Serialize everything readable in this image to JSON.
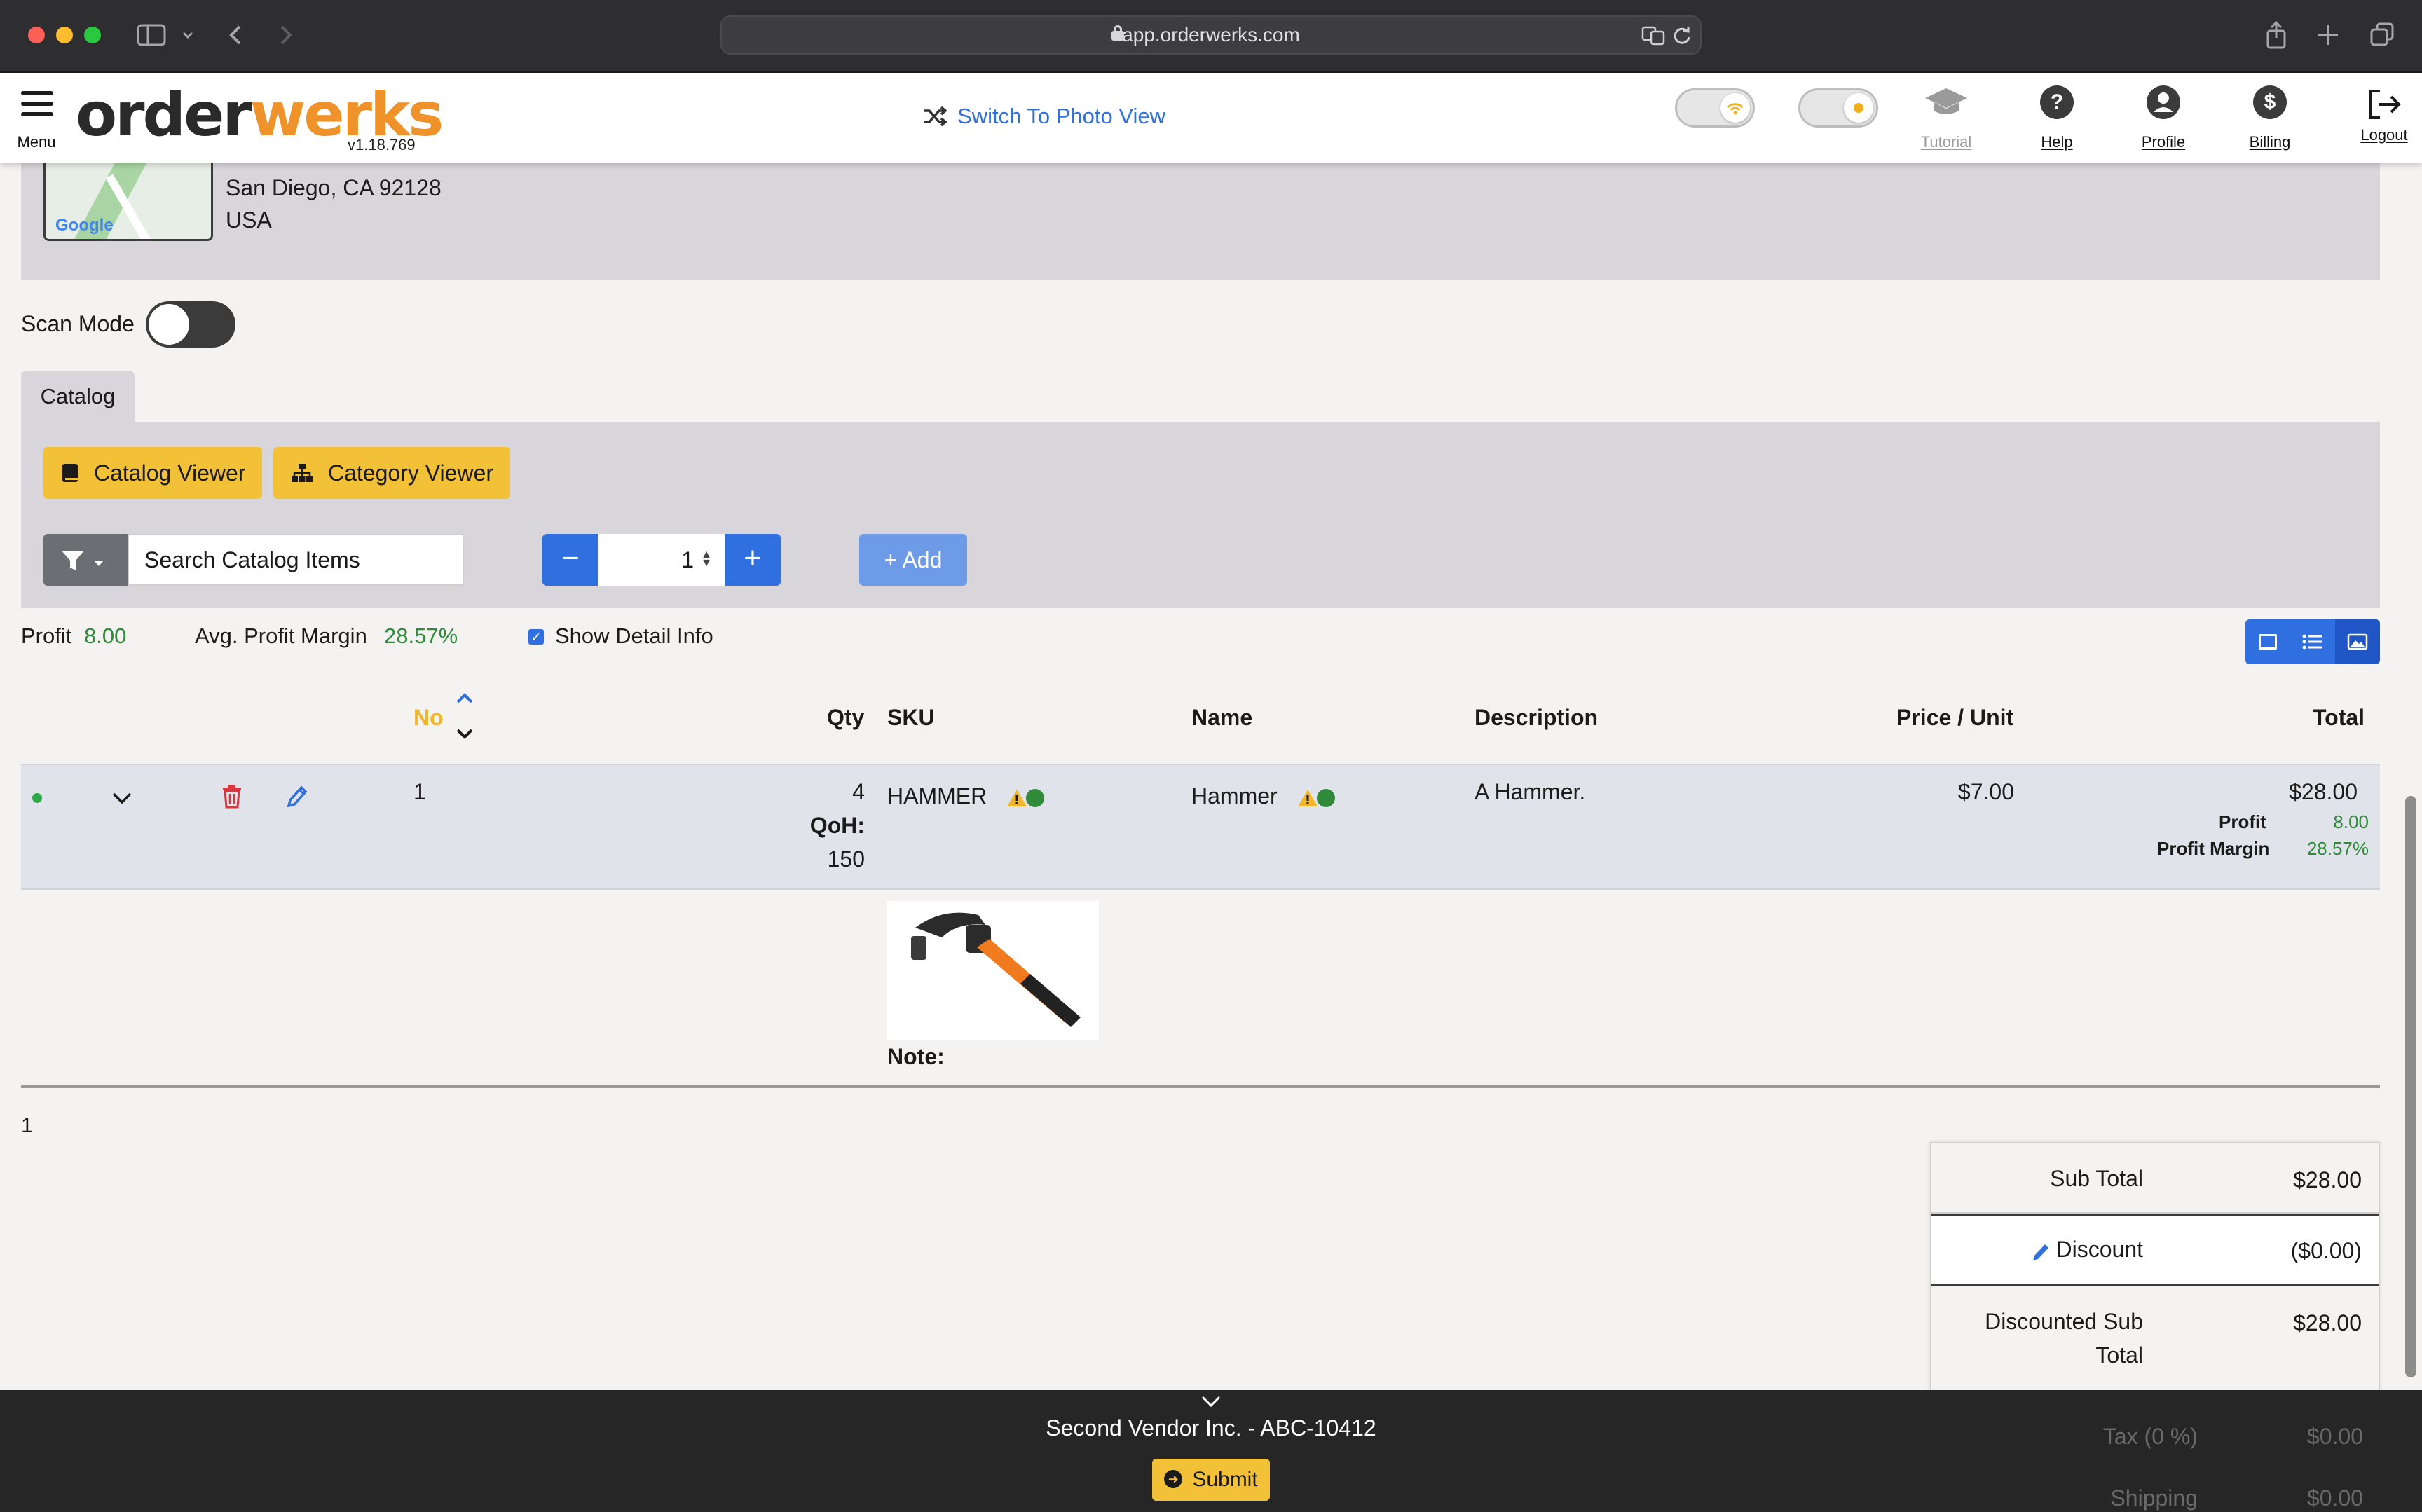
{
  "browser": {
    "url": "app.orderwerks.com"
  },
  "header": {
    "menu_label": "Menu",
    "logo_part1": "order",
    "logo_part2": "werks",
    "version": "v1.18.769",
    "switch_view": "Switch To Photo View",
    "links": {
      "tutorial": "Tutorial",
      "help": "Help",
      "profile": "Profile",
      "billing": "Billing",
      "logout": "Logout"
    },
    "help_glyph": "?",
    "billing_glyph": "$"
  },
  "address": {
    "map_brand": "Google",
    "line1": "San Diego, CA 92128",
    "line2": "USA"
  },
  "scan_mode": {
    "label": "Scan Mode",
    "on": false
  },
  "catalog": {
    "tab_label": "Catalog",
    "catalog_viewer": "Catalog Viewer",
    "category_viewer": "Category Viewer",
    "search_placeholder": "Search Catalog Items",
    "quantity": "1",
    "minus": "−",
    "plus": "+",
    "add_label": "+ Add"
  },
  "summary": {
    "profit_label": "Profit",
    "profit_value": "8.00",
    "margin_label": "Avg. Profit Margin",
    "margin_value": "28.57%",
    "show_detail_label": "Show Detail Info",
    "show_detail_checked": true,
    "check_glyph": "✓"
  },
  "table": {
    "headers": {
      "no": "No",
      "qty": "Qty",
      "sku": "SKU",
      "name": "Name",
      "description": "Description",
      "price_unit": "Price / Unit",
      "total": "Total"
    },
    "row": {
      "no": "1",
      "qty": "4",
      "qoh_label": "QoH:",
      "qoh_value": "150",
      "sku": "HAMMER",
      "name": "Hammer",
      "description": "A Hammer.",
      "price": "$7.00",
      "total": "$28.00",
      "profit_label": "Profit",
      "profit_value": "8.00",
      "margin_label": "Profit Margin",
      "margin_value": "28.57%",
      "note_label": "Note:"
    },
    "page_number": "1"
  },
  "totals": {
    "sub_total_label": "Sub Total",
    "sub_total": "$28.00",
    "discount_label": "Discount",
    "discount": "($0.00)",
    "discounted_label": "Discounted Sub Total",
    "discounted": "$28.00",
    "tax_label": "Tax (0 %)",
    "tax": "$0.00",
    "shipping_label": "Shipping",
    "shipping": "$0.00"
  },
  "footer": {
    "vendor": "Second Vendor Inc. - ABC-10412",
    "submit": "Submit",
    "submit_glyph": "➜"
  },
  "colors": {
    "brand_orange": "#f0922a",
    "accent_blue": "#2f6fe0",
    "button_yellow": "#f3c137",
    "profit_green": "#2f8a3a"
  }
}
